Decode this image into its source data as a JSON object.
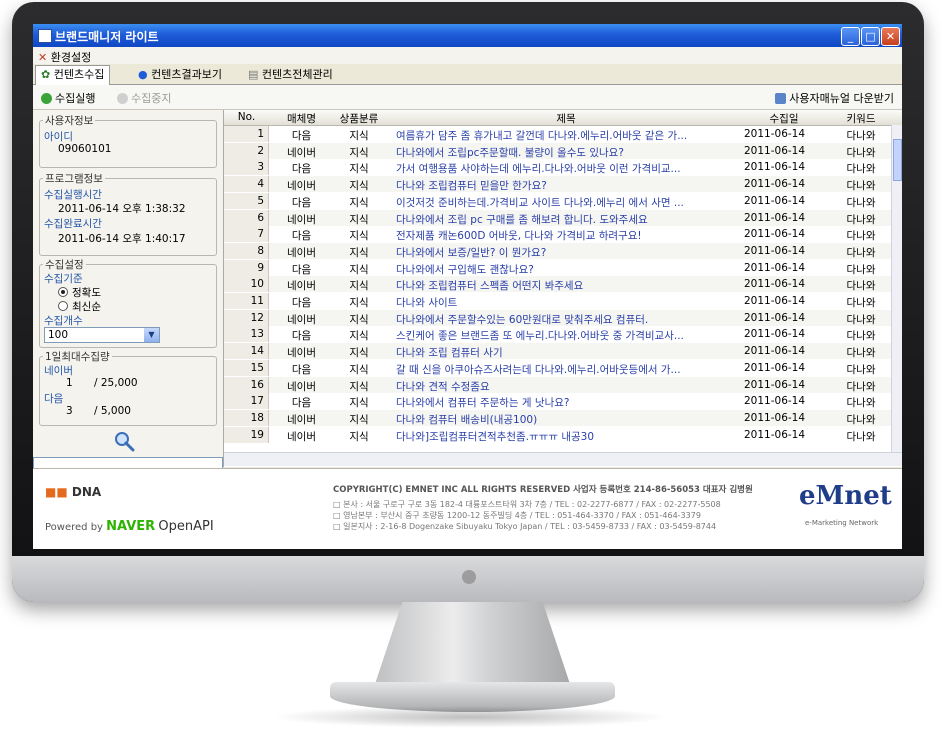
{
  "window": {
    "title": "브랜드매니저 라이트"
  },
  "menu": {
    "settings": "환경설정"
  },
  "tabs": [
    {
      "label": "컨텐츠수집"
    },
    {
      "label": "컨텐츠결과보기"
    },
    {
      "label": "컨텐츠전체관리"
    }
  ],
  "toolbar": {
    "run": "수집실행",
    "stop": "수집중지",
    "manual": "사용자매뉴얼 다운받기"
  },
  "user_info": {
    "title": "사용자정보",
    "id_label": "아이디",
    "id_value": "09060101"
  },
  "program_info": {
    "title": "프로그램정보",
    "start_label": "수집실행시간",
    "start_value": "2011-06-14 오후 1:38:32",
    "end_label": "수집완료시간",
    "end_value": "2011-06-14 오후 1:40:17"
  },
  "collect_settings": {
    "title": "수집설정",
    "criteria_label": "수집기준",
    "options": [
      "정확도",
      "최신순"
    ],
    "count_label": "수집개수",
    "count_value": "100"
  },
  "daily_max": {
    "title": "1일최대수집량",
    "naver_label": "네이버",
    "naver_used": "1",
    "naver_max": "/ 25,000",
    "daum_label": "다음",
    "daum_used": "3",
    "daum_max": "/ 5,000"
  },
  "table": {
    "headers": [
      "No.",
      "매체명",
      "상품분류",
      "제목",
      "수집일",
      "키워드"
    ],
    "rows": [
      {
        "no": "1",
        "media": "다음",
        "cat": "지식",
        "title": "여름휴가 담주 좀 휴가내고 갈껀데 다나와.에누리.어바웃 같은 가...",
        "date": "2011-06-14",
        "kw": "다나와"
      },
      {
        "no": "2",
        "media": "네이버",
        "cat": "지식",
        "title": "다나와에서 조립pc주문할때. 불량이 올수도 있나요?",
        "date": "2011-06-14",
        "kw": "다나와"
      },
      {
        "no": "3",
        "media": "다음",
        "cat": "지식",
        "title": "가서 여행용품 사야하는데 에누리.다나와.어바웃 이런 가격비교...",
        "date": "2011-06-14",
        "kw": "다나와"
      },
      {
        "no": "4",
        "media": "네이버",
        "cat": "지식",
        "title": "다나와 조립컴퓨터 믿을만 한가요?",
        "date": "2011-06-14",
        "kw": "다나와"
      },
      {
        "no": "5",
        "media": "다음",
        "cat": "지식",
        "title": "이것저것 준비하는데.가격비교 사이트 다나와.에누리 에서 사면 ...",
        "date": "2011-06-14",
        "kw": "다나와"
      },
      {
        "no": "6",
        "media": "네이버",
        "cat": "지식",
        "title": "다나와에서 조립 pc 구매를 좀 해보려 합니다. 도와주세요",
        "date": "2011-06-14",
        "kw": "다나와"
      },
      {
        "no": "7",
        "media": "다음",
        "cat": "지식",
        "title": "전자제품 캐논600D 어바웃, 다나와 가격비교 하려구요!",
        "date": "2011-06-14",
        "kw": "다나와"
      },
      {
        "no": "8",
        "media": "네이버",
        "cat": "지식",
        "title": "다나와에서 보증/일반? 이 뭔가요?",
        "date": "2011-06-14",
        "kw": "다나와"
      },
      {
        "no": "9",
        "media": "다음",
        "cat": "지식",
        "title": "다나와에서 구입해도 괜찮나요?",
        "date": "2011-06-14",
        "kw": "다나와"
      },
      {
        "no": "10",
        "media": "네이버",
        "cat": "지식",
        "title": "다나와 조립컴퓨터 스펙좀 어떤지 봐주세요",
        "date": "2011-06-14",
        "kw": "다나와"
      },
      {
        "no": "11",
        "media": "다음",
        "cat": "지식",
        "title": "다나와 사이트",
        "date": "2011-06-14",
        "kw": "다나와"
      },
      {
        "no": "12",
        "media": "네이버",
        "cat": "지식",
        "title": "다나와에서 주문할수있는 60만원대로 맞춰주세요 컴퓨터.",
        "date": "2011-06-14",
        "kw": "다나와"
      },
      {
        "no": "13",
        "media": "다음",
        "cat": "지식",
        "title": "스킨케어 좋은 브랜드좀 또 에누리.다나와.어바웃 중 가격비교사...",
        "date": "2011-06-14",
        "kw": "다나와"
      },
      {
        "no": "14",
        "media": "네이버",
        "cat": "지식",
        "title": "다나와 조립 컴퓨터 사기",
        "date": "2011-06-14",
        "kw": "다나와"
      },
      {
        "no": "15",
        "media": "다음",
        "cat": "지식",
        "title": "갈 때 신을 아쿠아슈즈사려는데 다나와.에누리.어바웃등에서 가...",
        "date": "2011-06-14",
        "kw": "다나와"
      },
      {
        "no": "16",
        "media": "네이버",
        "cat": "지식",
        "title": "다나와 견적 수정좀요",
        "date": "2011-06-14",
        "kw": "다나와"
      },
      {
        "no": "17",
        "media": "다음",
        "cat": "지식",
        "title": "다나와에서 컴퓨터 주문하는 게 낫나요?",
        "date": "2011-06-14",
        "kw": "다나와"
      },
      {
        "no": "18",
        "media": "네이버",
        "cat": "지식",
        "title": "다나와 컴퓨터 배송비(내공100)",
        "date": "2011-06-14",
        "kw": "다나와"
      },
      {
        "no": "19",
        "media": "네이버",
        "cat": "지식",
        "title": "다나와]조립컴퓨터견적추천좀.ㅠㅠㅠ 내공30",
        "date": "2011-06-14",
        "kw": "다나와"
      }
    ]
  },
  "footer": {
    "logo": "DNA",
    "powered_by": "Powered by",
    "naver": "NAVER",
    "openapi": "OpenAPI",
    "copyright": "COPYRIGHT(C) EMNET INC ALL RIGHTS RESERVED   사업자 등록번호 214-86-56053 대표자 김병원",
    "addr1": "□ 본사 : 서울 구로구 구로 3동 182-4 대륭포스트타워 3차 7층 / TEL : 02-2277-6877 / FAX : 02-2277-5508",
    "addr2": "□ 영남본부 : 부산시 중구 초량동 1200-12 동주빌딩 4층 / TEL : 051-464-3370 / FAX : 051-464-3379",
    "addr3": "□ 일본지사 : 2-16-8 Dogenzake Sibuyaku Tokyo Japan / TEL : 03-5459-8733 / FAX : 03-5459-8744",
    "brand": "eMnet",
    "brand_sub": "e-Marketing Network"
  }
}
